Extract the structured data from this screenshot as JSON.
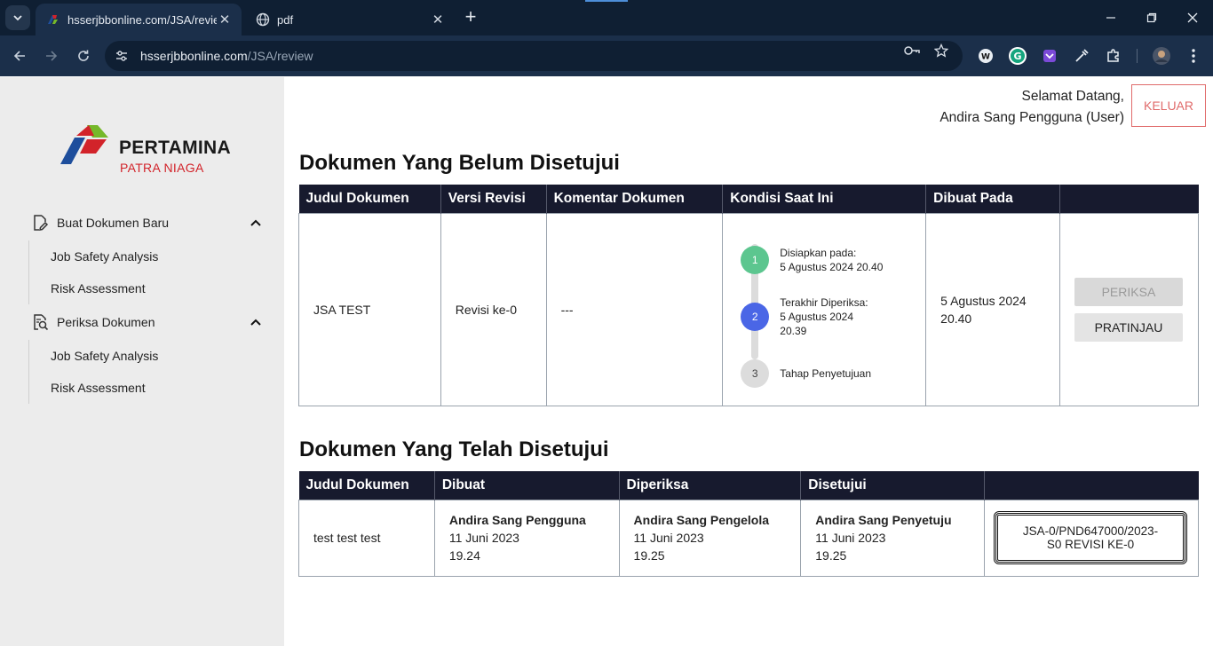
{
  "browser": {
    "tabs": [
      {
        "title": "hsserjbbonline.com/JSA/review",
        "active": true
      },
      {
        "title": "pdf",
        "active": false
      }
    ],
    "url_host": "hsserjbbonline.com",
    "url_path": "/JSA/review"
  },
  "brand": {
    "name": "PERTAMINA",
    "sub": "PATRA NIAGA",
    "colors": {
      "red": "#d2232a",
      "green": "#76b82a",
      "blue": "#1e4e9c"
    }
  },
  "sidebar": {
    "groups": [
      {
        "label": "Buat Dokumen Baru",
        "icon": "document-edit-icon",
        "items": [
          "Job Safety Analysis",
          "Risk Assessment"
        ]
      },
      {
        "label": "Periksa Dokumen",
        "icon": "document-search-icon",
        "items": [
          "Job Safety Analysis",
          "Risk Assessment"
        ]
      }
    ]
  },
  "header": {
    "greeting": "Selamat Datang,",
    "user": "Andira Sang Pengguna (User)",
    "logout": "KELUAR"
  },
  "pending": {
    "title": "Dokumen Yang Belum Disetujui",
    "columns": [
      "Judul Dokumen",
      "Versi Revisi",
      "Komentar Dokumen",
      "Kondisi Saat Ini",
      "Dibuat Pada",
      ""
    ],
    "row": {
      "title": "JSA TEST",
      "revision": "Revisi ke-0",
      "comment": "---",
      "steps": [
        {
          "num": "1",
          "label": "Disiapkan pada:",
          "detail": "5 Agustus 2024 20.40",
          "color": "#5cc68f"
        },
        {
          "num": "2",
          "label": "Terakhir Diperiksa:",
          "detail": "5 Agustus 2024",
          "detail2": "20.39",
          "color": "#4a66e6"
        },
        {
          "num": "3",
          "label": "Tahap Penyetujuan",
          "color": "#dcdcdc"
        }
      ],
      "created_date": "5 Agustus 2024",
      "created_time": "20.40",
      "btn_check": "PERIKSA",
      "btn_preview": "PRATINJAU"
    }
  },
  "approved": {
    "title": "Dokumen Yang Telah Disetujui",
    "columns": [
      "Judul Dokumen",
      "Dibuat",
      "Diperiksa",
      "Disetujui",
      ""
    ],
    "row": {
      "title": "test test test",
      "made": {
        "name": "Andira Sang Pengguna",
        "date": "11 Juni 2023",
        "time": "19.24"
      },
      "checked": {
        "name": "Andira Sang Pengelola",
        "date": "11 Juni 2023",
        "time": "19.25"
      },
      "approved": {
        "name": "Andira Sang Penyetuju",
        "date": "11 Juni 2023",
        "time": "19.25"
      },
      "doc_line1": "JSA-0/PND647000/2023-",
      "doc_line2": "S0 REVISI KE-0"
    }
  }
}
